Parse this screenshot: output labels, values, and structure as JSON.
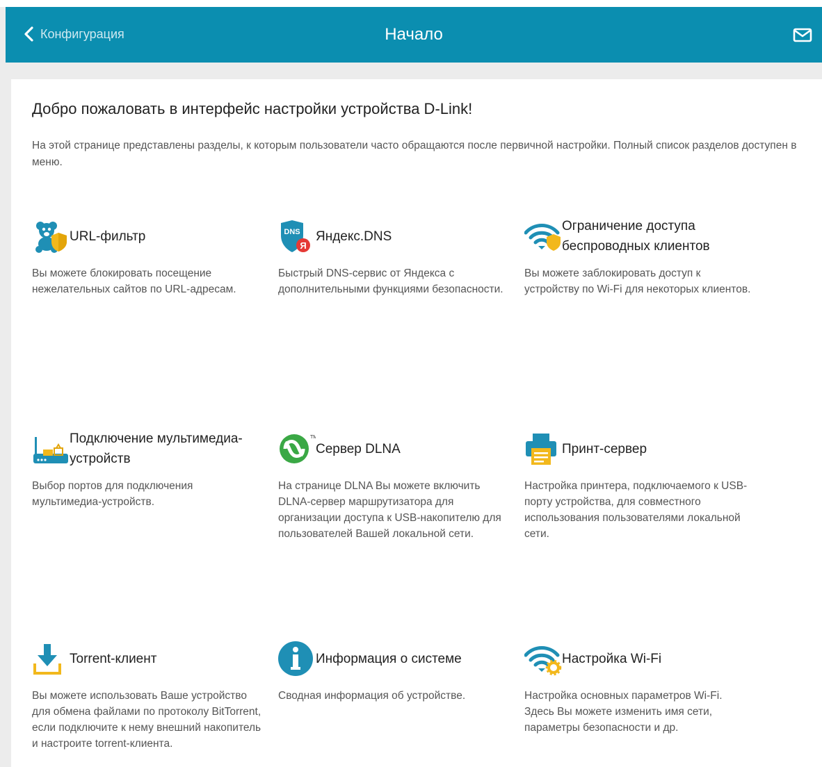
{
  "header": {
    "back_label": "Конфигурация",
    "title": "Начало",
    "bg_color": "#0b8eb0",
    "mail_icon": "mail-icon"
  },
  "welcome": {
    "heading": "Добро пожаловать в интерфейс настройки устройства D-Link!",
    "intro": "На этой странице представлены разделы, к которым пользователи часто обращаются после первичной настройки. Полный список разделов доступен в меню."
  },
  "cards": [
    {
      "title": "URL-фильтр",
      "desc": "Вы можете блокировать посещение нежелательных сайтов по URL-адресам.",
      "icon": "url-filter-icon"
    },
    {
      "title": "Яндекс.DNS",
      "desc": "Быстрый DNS-сервис от Яндекса с дополнительными функциями безопасности.",
      "icon": "yandex-dns-icon"
    },
    {
      "title": "Ограничение доступа беспроводных клиентов",
      "desc": "Вы можете заблокировать доступ к устройству по Wi-Fi для некоторых клиентов.",
      "icon": "wifi-shield-icon"
    },
    {
      "title": "Подключение мультимедиа-устройств",
      "desc": "Выбор портов для подключения мультимедиа-устройств.",
      "icon": "multimedia-icon"
    },
    {
      "title": "Сервер DLNA",
      "desc": "На странице DLNA Вы можете включить DLNA-сервер маршрутизатора для организации доступа к USB-накопителю для пользователей Вашей локальной сети.",
      "icon": "dlna-icon"
    },
    {
      "title": "Принт-сервер",
      "desc": "Настройка принтера, подключаемого к USB-порту устройства, для совместного использования пользователями локальной сети.",
      "icon": "printer-icon"
    },
    {
      "title": "Torrent-клиент",
      "desc": "Вы можете использовать Ваше устройство для обмена файлами по протоколу BitTorrent, если подключите к нему внешний накопитель и настроите torrent-клиента.",
      "icon": "download-icon"
    },
    {
      "title": "Информация о системе",
      "desc": "Сводная информация об устройстве.",
      "icon": "info-icon"
    },
    {
      "title": "Настройка Wi-Fi",
      "desc": "Настройка основных параметров Wi-Fi. Здесь Вы можете изменить имя сети, параметры безопасности и др.",
      "icon": "wifi-settings-icon"
    }
  ]
}
